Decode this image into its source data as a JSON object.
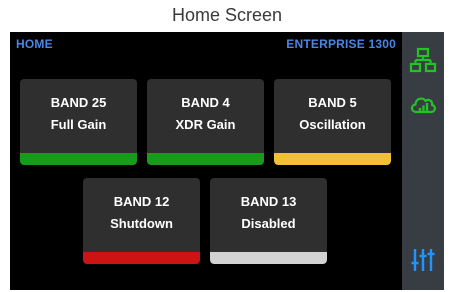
{
  "caption": "Home Screen",
  "header": {
    "left": "HOME",
    "right": "ENTERPRISE 1300"
  },
  "bands": [
    {
      "name": "BAND 25",
      "status": "Full Gain",
      "status_color": "#1a9a1a"
    },
    {
      "name": "BAND 4",
      "status": "XDR Gain",
      "status_color": "#1a9a1a"
    },
    {
      "name": "BAND 5",
      "status": "Oscillation",
      "status_color": "#f2c037"
    },
    {
      "name": "BAND 12",
      "status": "Shutdown",
      "status_color": "#cc1414"
    },
    {
      "name": "BAND 13",
      "status": "Disabled",
      "status_color": "#d2d2d2"
    }
  ],
  "sidebar": {
    "icons": [
      "network-icon",
      "cloud-signal-icon",
      "equalizer-icon"
    ],
    "icon_color": "#22c322",
    "settings_icon_color": "#1e96ff"
  }
}
